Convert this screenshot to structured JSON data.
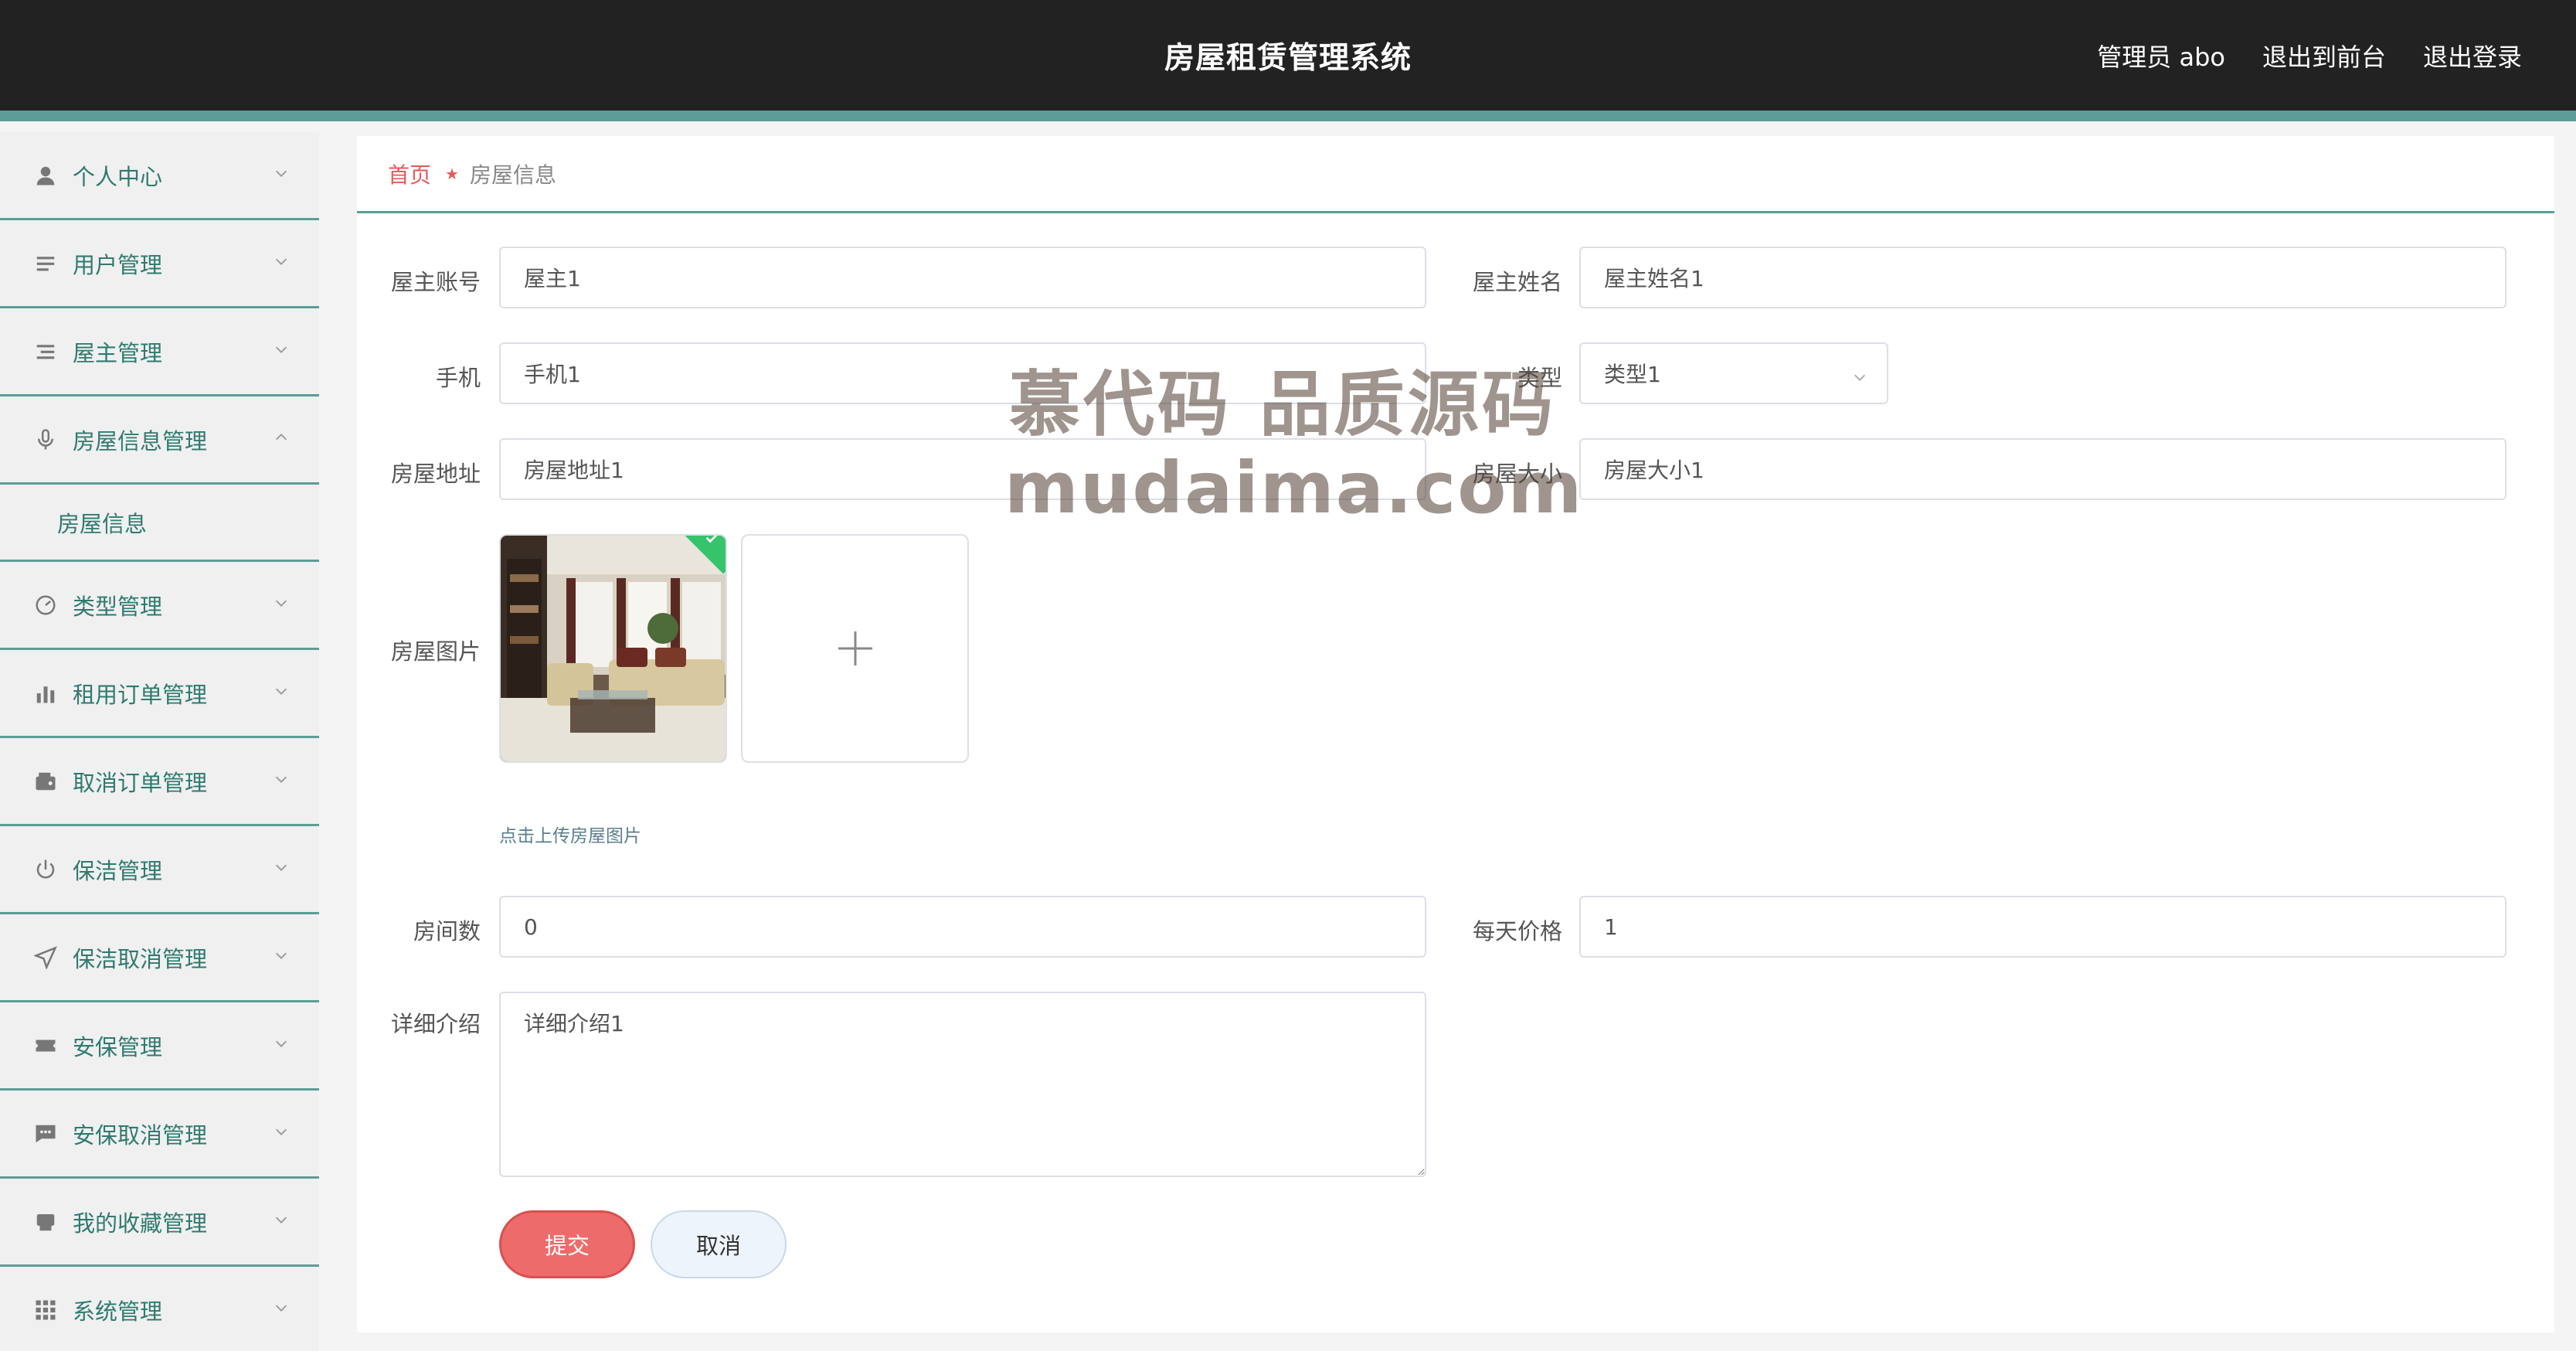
{
  "header": {
    "title": "房屋租赁管理系统",
    "user_label": "管理员 abo",
    "to_front_label": "退出到前台",
    "logout_label": "退出登录"
  },
  "sidebar": {
    "items": [
      {
        "label": "个人中心",
        "icon": "user-icon"
      },
      {
        "label": "用户管理",
        "icon": "list-icon"
      },
      {
        "label": "屋主管理",
        "icon": "list-icon"
      },
      {
        "label": "房屋信息管理",
        "icon": "microphone-icon",
        "expanded": true
      },
      {
        "label": "类型管理",
        "icon": "gauge-icon"
      },
      {
        "label": "租用订单管理",
        "icon": "bar-chart-icon"
      },
      {
        "label": "取消订单管理",
        "icon": "wallet-icon"
      },
      {
        "label": "保洁管理",
        "icon": "power-icon"
      },
      {
        "label": "保洁取消管理",
        "icon": "send-icon"
      },
      {
        "label": "安保管理",
        "icon": "ticket-icon"
      },
      {
        "label": "安保取消管理",
        "icon": "chat-icon"
      },
      {
        "label": "我的收藏管理",
        "icon": "printer-icon"
      },
      {
        "label": "系统管理",
        "icon": "grid-icon"
      }
    ],
    "sub_item": "房屋信息"
  },
  "breadcrumb": {
    "home": "首页",
    "current": "房屋信息"
  },
  "form": {
    "owner_account": {
      "label": "屋主账号",
      "value": "屋主1"
    },
    "owner_name": {
      "label": "屋主姓名",
      "value": "屋主姓名1"
    },
    "phone": {
      "label": "手机",
      "value": "手机1"
    },
    "type": {
      "label": "类型",
      "value": "类型1"
    },
    "address": {
      "label": "房屋地址",
      "value": "房屋地址1"
    },
    "size": {
      "label": "房屋大小",
      "value": "房屋大小1"
    },
    "image": {
      "label": "房屋图片",
      "tip": "点击上传房屋图片"
    },
    "rooms": {
      "label": "房间数",
      "value": "0"
    },
    "daily_price": {
      "label": "每天价格",
      "value": "1"
    },
    "description": {
      "label": "详细介绍",
      "value": "详细介绍1"
    }
  },
  "buttons": {
    "submit": "提交",
    "cancel": "取消"
  },
  "watermark": {
    "line1": "慕代码 品质源码",
    "line2": "mudaima.com"
  },
  "colors": {
    "accent": "#5c9d97",
    "menu_text": "#2f7a70",
    "submit": "#ee6b6b",
    "home_link": "#e65a5a"
  }
}
